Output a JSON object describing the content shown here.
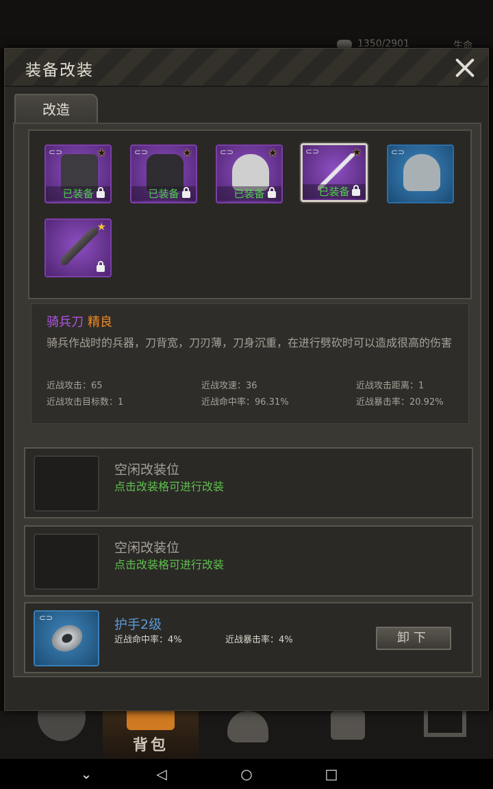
{
  "background": {
    "resource_text": "1350/2901",
    "resource_text_right": "生命",
    "nav": {
      "bag_label": "背包"
    }
  },
  "modal": {
    "title": "装备改装",
    "tab_label": "改造",
    "inventory": [
      {
        "item": "pants",
        "equipped_label": "已装备",
        "rarity_color": "#8e4fc2",
        "locked": true,
        "starred": true
      },
      {
        "item": "jacket",
        "equipped_label": "已装备",
        "rarity_color": "#8e4fc2",
        "locked": true,
        "starred": true
      },
      {
        "item": "police-helmet",
        "equipped_label": "已装备",
        "rarity_color": "#8e4fc2",
        "locked": true,
        "starred": true
      },
      {
        "item": "cavalry-sabre",
        "equipped_label": "已装备",
        "rarity_color": "#8e4fc2",
        "locked": true,
        "starred": true,
        "selected": true
      },
      {
        "item": "helmet",
        "equipped_label": "",
        "rarity_color": "#3d88c2",
        "locked": false,
        "starred": false
      },
      {
        "item": "machete",
        "equipped_label": "",
        "rarity_color": "#8e4fc2",
        "locked": true,
        "starred": true
      }
    ],
    "details": {
      "name": "骑兵刀",
      "quality": "精良",
      "name_color": "#b255e6",
      "quality_color": "#f08a24",
      "description": "骑兵作战时的兵器，刀背宽，刀刃薄，刀身沉重，在进行劈砍时可以造成很高的伤害",
      "stats": [
        "近战攻击：65",
        "近战攻速：36",
        "近战攻击距离：1",
        "近战攻击目标数：1",
        "近战命中率：96.31%",
        "近战暴击率：20.92%"
      ]
    },
    "mod_slots": [
      {
        "title": "空闲改装位",
        "hint": "点击改装格可进行改装"
      },
      {
        "title": "空闲改装位",
        "hint": "点击改装格可进行改装"
      }
    ],
    "installed_mod": {
      "name": "护手2级",
      "stats": [
        "近战命中率：4%",
        "近战暴击率：4%"
      ],
      "unequip_label": "卸下"
    }
  }
}
